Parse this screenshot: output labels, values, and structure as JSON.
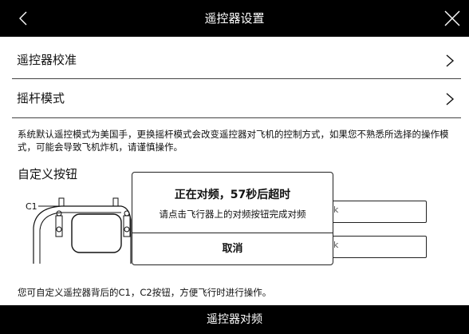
{
  "header": {
    "title": "遥控器设置"
  },
  "rows": [
    {
      "label": "遥控器校准"
    },
    {
      "label": "摇杆模式"
    }
  ],
  "description": "系统默认遥控模式为美国手，更换摇杆模式会改变遥控器对飞机的控制方式，如果您不熟悉所选择的操作模式，可能会导致飞机炸机，请谨慎操作。",
  "custom_buttons": {
    "title": "自定义按钮",
    "c1_label": "C1",
    "field_1_visible_text": "k",
    "field_2_visible_text": "k"
  },
  "footnote": "您可自定义遥控器背后的C1，C2按钮，方便飞行时进行操作。",
  "bottom_bar": {
    "label": "遥控器对频"
  },
  "dialog": {
    "title": "正在对频，57秒后超时",
    "message": "请点击飞行器上的对频按钮完成对频",
    "cancel_label": "取消"
  }
}
